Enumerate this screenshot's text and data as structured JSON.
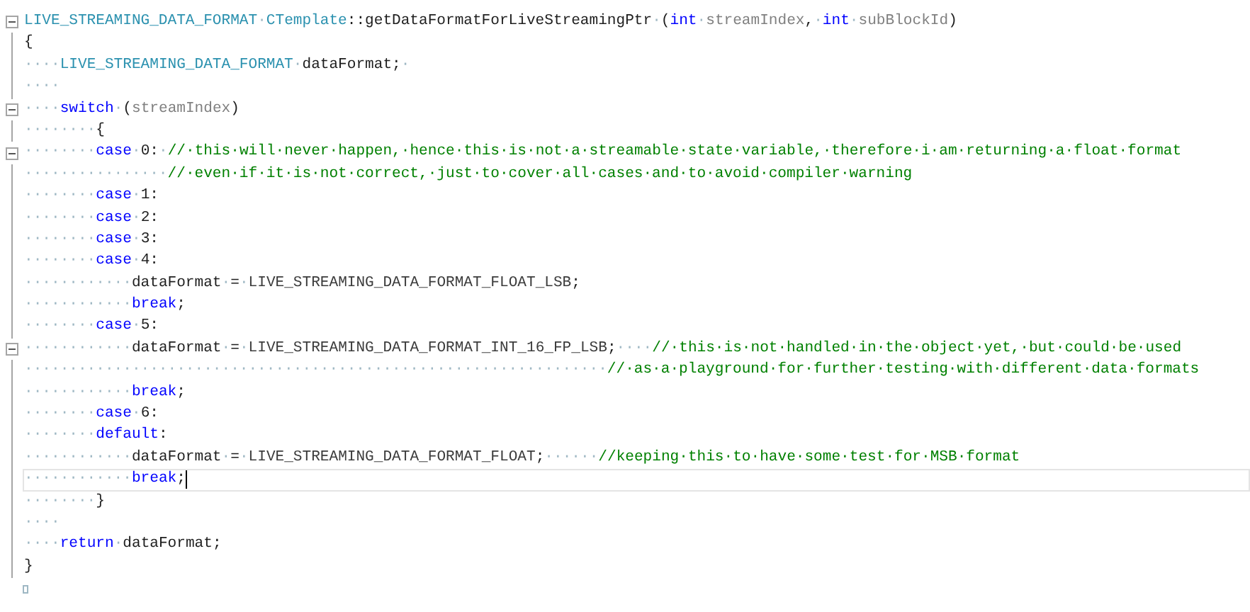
{
  "lines": [
    {
      "fold": true,
      "current": false,
      "tokens": [
        {
          "kind": "type",
          "text": "LIVE_STREAMING_DATA_FORMAT"
        },
        {
          "kind": "ws",
          "text": "·"
        },
        {
          "kind": "type",
          "text": "CTemplate"
        },
        {
          "kind": "plain",
          "text": "::getDataFormatForLiveStreamingPtr"
        },
        {
          "kind": "ws",
          "text": "·"
        },
        {
          "kind": "plain",
          "text": "("
        },
        {
          "kind": "kw",
          "text": "int"
        },
        {
          "kind": "ws",
          "text": "·"
        },
        {
          "kind": "param",
          "text": "streamIndex"
        },
        {
          "kind": "plain",
          "text": ","
        },
        {
          "kind": "ws",
          "text": "·"
        },
        {
          "kind": "kw",
          "text": "int"
        },
        {
          "kind": "ws",
          "text": "·"
        },
        {
          "kind": "param",
          "text": "subBlockId"
        },
        {
          "kind": "plain",
          "text": ")"
        }
      ]
    },
    {
      "fold": false,
      "current": false,
      "tokens": [
        {
          "kind": "plain",
          "text": "{"
        }
      ]
    },
    {
      "fold": false,
      "current": false,
      "tokens": [
        {
          "kind": "ws",
          "text": "····"
        },
        {
          "kind": "type",
          "text": "LIVE_STREAMING_DATA_FORMAT"
        },
        {
          "kind": "ws",
          "text": "·"
        },
        {
          "kind": "plain",
          "text": "dataFormat;"
        },
        {
          "kind": "ws",
          "text": "·"
        }
      ]
    },
    {
      "fold": false,
      "current": false,
      "tokens": [
        {
          "kind": "ws",
          "text": "····"
        }
      ]
    },
    {
      "fold": true,
      "current": false,
      "tokens": [
        {
          "kind": "ws",
          "text": "····"
        },
        {
          "kind": "kw",
          "text": "switch"
        },
        {
          "kind": "ws",
          "text": "·"
        },
        {
          "kind": "plain",
          "text": "("
        },
        {
          "kind": "param",
          "text": "streamIndex"
        },
        {
          "kind": "plain",
          "text": ")"
        }
      ]
    },
    {
      "fold": false,
      "current": false,
      "tokens": [
        {
          "kind": "ws",
          "text": "········"
        },
        {
          "kind": "plain",
          "text": "{"
        }
      ]
    },
    {
      "fold": true,
      "current": false,
      "tokens": [
        {
          "kind": "ws",
          "text": "········"
        },
        {
          "kind": "kw",
          "text": "case"
        },
        {
          "kind": "ws",
          "text": "·"
        },
        {
          "kind": "plain",
          "text": "0:"
        },
        {
          "kind": "ws",
          "text": "·"
        },
        {
          "kind": "comment",
          "text": "//·this·will·never·happen,·hence·this·is·not·a·streamable·state·variable,·therefore·i·am·returning·a·float·format"
        }
      ]
    },
    {
      "fold": false,
      "current": false,
      "tokens": [
        {
          "kind": "ws",
          "text": "················"
        },
        {
          "kind": "comment",
          "text": "//·even·if·it·is·not·correct,·just·to·cover·all·cases·and·to·avoid·compiler·warning"
        }
      ]
    },
    {
      "fold": false,
      "current": false,
      "tokens": [
        {
          "kind": "ws",
          "text": "········"
        },
        {
          "kind": "kw",
          "text": "case"
        },
        {
          "kind": "ws",
          "text": "·"
        },
        {
          "kind": "plain",
          "text": "1:"
        }
      ]
    },
    {
      "fold": false,
      "current": false,
      "tokens": [
        {
          "kind": "ws",
          "text": "········"
        },
        {
          "kind": "kw",
          "text": "case"
        },
        {
          "kind": "ws",
          "text": "·"
        },
        {
          "kind": "plain",
          "text": "2:"
        }
      ]
    },
    {
      "fold": false,
      "current": false,
      "tokens": [
        {
          "kind": "ws",
          "text": "········"
        },
        {
          "kind": "kw",
          "text": "case"
        },
        {
          "kind": "ws",
          "text": "·"
        },
        {
          "kind": "plain",
          "text": "3:"
        }
      ]
    },
    {
      "fold": false,
      "current": false,
      "tokens": [
        {
          "kind": "ws",
          "text": "········"
        },
        {
          "kind": "kw",
          "text": "case"
        },
        {
          "kind": "ws",
          "text": "·"
        },
        {
          "kind": "plain",
          "text": "4:"
        }
      ]
    },
    {
      "fold": false,
      "current": false,
      "tokens": [
        {
          "kind": "ws",
          "text": "············"
        },
        {
          "kind": "plain",
          "text": "dataFormat"
        },
        {
          "kind": "ws",
          "text": "·"
        },
        {
          "kind": "plain",
          "text": "="
        },
        {
          "kind": "ws",
          "text": "·"
        },
        {
          "kind": "macro",
          "text": "LIVE_STREAMING_DATA_FORMAT_FLOAT_LSB"
        },
        {
          "kind": "plain",
          "text": ";"
        }
      ]
    },
    {
      "fold": false,
      "current": false,
      "tokens": [
        {
          "kind": "ws",
          "text": "············"
        },
        {
          "kind": "kw",
          "text": "break"
        },
        {
          "kind": "plain",
          "text": ";"
        }
      ]
    },
    {
      "fold": false,
      "current": false,
      "tokens": [
        {
          "kind": "ws",
          "text": "········"
        },
        {
          "kind": "kw",
          "text": "case"
        },
        {
          "kind": "ws",
          "text": "·"
        },
        {
          "kind": "plain",
          "text": "5:"
        }
      ]
    },
    {
      "fold": true,
      "current": false,
      "tokens": [
        {
          "kind": "ws",
          "text": "············"
        },
        {
          "kind": "plain",
          "text": "dataFormat"
        },
        {
          "kind": "ws",
          "text": "·"
        },
        {
          "kind": "plain",
          "text": "="
        },
        {
          "kind": "ws",
          "text": "·"
        },
        {
          "kind": "macro",
          "text": "LIVE_STREAMING_DATA_FORMAT_INT_16_FP_LSB"
        },
        {
          "kind": "plain",
          "text": ";"
        },
        {
          "kind": "ws",
          "text": "····"
        },
        {
          "kind": "comment",
          "text": "//·this·is·not·handled·in·the·object·yet,·but·could·be·used"
        }
      ]
    },
    {
      "fold": false,
      "current": false,
      "tokens": [
        {
          "kind": "ws",
          "text": "·································································"
        },
        {
          "kind": "comment",
          "text": "//·as·a·playground·for·further·testing·with·different·data·formats"
        }
      ]
    },
    {
      "fold": false,
      "current": false,
      "tokens": [
        {
          "kind": "ws",
          "text": "············"
        },
        {
          "kind": "kw",
          "text": "break"
        },
        {
          "kind": "plain",
          "text": ";"
        }
      ]
    },
    {
      "fold": false,
      "current": false,
      "tokens": [
        {
          "kind": "ws",
          "text": "········"
        },
        {
          "kind": "kw",
          "text": "case"
        },
        {
          "kind": "ws",
          "text": "·"
        },
        {
          "kind": "plain",
          "text": "6:"
        }
      ]
    },
    {
      "fold": false,
      "current": false,
      "tokens": [
        {
          "kind": "ws",
          "text": "········"
        },
        {
          "kind": "kw",
          "text": "default"
        },
        {
          "kind": "plain",
          "text": ":"
        }
      ]
    },
    {
      "fold": false,
      "current": false,
      "tokens": [
        {
          "kind": "ws",
          "text": "············"
        },
        {
          "kind": "plain",
          "text": "dataFormat"
        },
        {
          "kind": "ws",
          "text": "·"
        },
        {
          "kind": "plain",
          "text": "="
        },
        {
          "kind": "ws",
          "text": "·"
        },
        {
          "kind": "macro",
          "text": "LIVE_STREAMING_DATA_FORMAT_FLOAT"
        },
        {
          "kind": "plain",
          "text": ";"
        },
        {
          "kind": "ws",
          "text": "······"
        },
        {
          "kind": "comment",
          "text": "//keeping·this·to·have·some·test·for·MSB·format"
        }
      ]
    },
    {
      "fold": false,
      "current": true,
      "tokens": [
        {
          "kind": "ws",
          "text": "············"
        },
        {
          "kind": "kw",
          "text": "break"
        },
        {
          "kind": "plain",
          "text": ";"
        }
      ]
    },
    {
      "fold": false,
      "current": false,
      "tokens": [
        {
          "kind": "ws",
          "text": "········"
        },
        {
          "kind": "plain",
          "text": "}"
        }
      ]
    },
    {
      "fold": false,
      "current": false,
      "tokens": [
        {
          "kind": "ws",
          "text": "····"
        }
      ]
    },
    {
      "fold": false,
      "current": false,
      "tokens": [
        {
          "kind": "ws",
          "text": "····"
        },
        {
          "kind": "kw",
          "text": "return"
        },
        {
          "kind": "ws",
          "text": "·"
        },
        {
          "kind": "plain",
          "text": "dataFormat;"
        }
      ]
    },
    {
      "fold": false,
      "current": false,
      "tokens": [
        {
          "kind": "plain",
          "text": "}"
        }
      ]
    }
  ]
}
